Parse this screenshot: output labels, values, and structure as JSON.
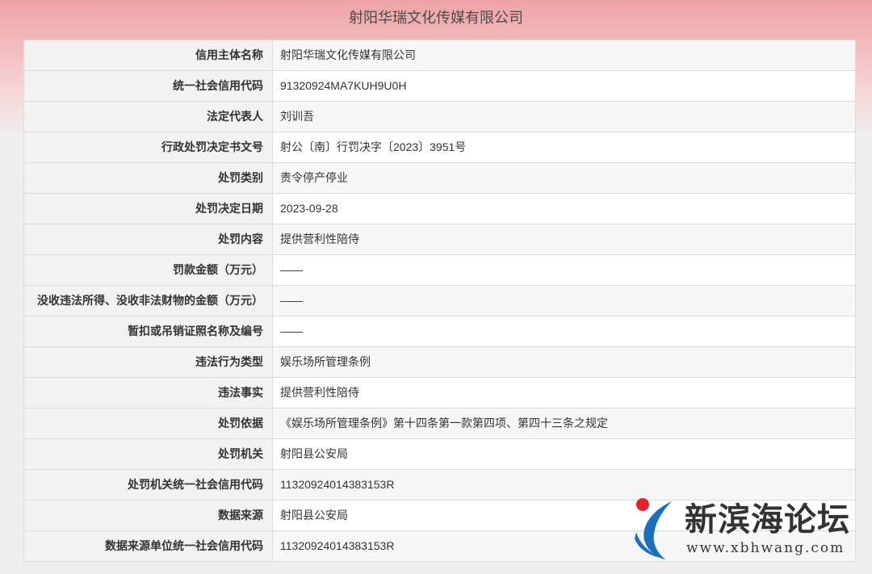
{
  "header": {
    "title": "射阳华瑞文化传媒有限公司"
  },
  "rows": [
    {
      "label": "信用主体名称",
      "value": "射阳华瑞文化传媒有限公司"
    },
    {
      "label": "统一社会信用代码",
      "value": "91320924MA7KUH9U0H"
    },
    {
      "label": "法定代表人",
      "value": "刘训吾"
    },
    {
      "label": "行政处罚决定书文号",
      "value": "射公〔南〕行罚决字〔2023〕3951号"
    },
    {
      "label": "处罚类别",
      "value": "责令停产停业"
    },
    {
      "label": "处罚决定日期",
      "value": "2023-09-28"
    },
    {
      "label": "处罚内容",
      "value": "提供营利性陪侍"
    },
    {
      "label": "罚款金额（万元）",
      "value": "——"
    },
    {
      "label": "没收违法所得、没收非法财物的金额（万元）",
      "value": "——"
    },
    {
      "label": "暂扣或吊销证照名称及编号",
      "value": "——"
    },
    {
      "label": "违法行为类型",
      "value": "娱乐场所管理条例"
    },
    {
      "label": "违法事实",
      "value": "提供营利性陪侍"
    },
    {
      "label": "处罚依据",
      "value": "《娱乐场所管理条例》第十四条第一款第四项、第四十三条之规定"
    },
    {
      "label": "处罚机关",
      "value": "射阳县公安局"
    },
    {
      "label": "处罚机关统一社会信用代码",
      "value": "11320924014383153R"
    },
    {
      "label": "数据来源",
      "value": "射阳县公安局"
    },
    {
      "label": "数据来源单位统一社会信用代码",
      "value": "11320924014383153R"
    }
  ],
  "watermark": {
    "name": "新滨海论坛",
    "url": "www.xbhwang.com",
    "logo_colors": {
      "dot": "#e8202a",
      "swoosh": "#1a6fc1"
    }
  }
}
